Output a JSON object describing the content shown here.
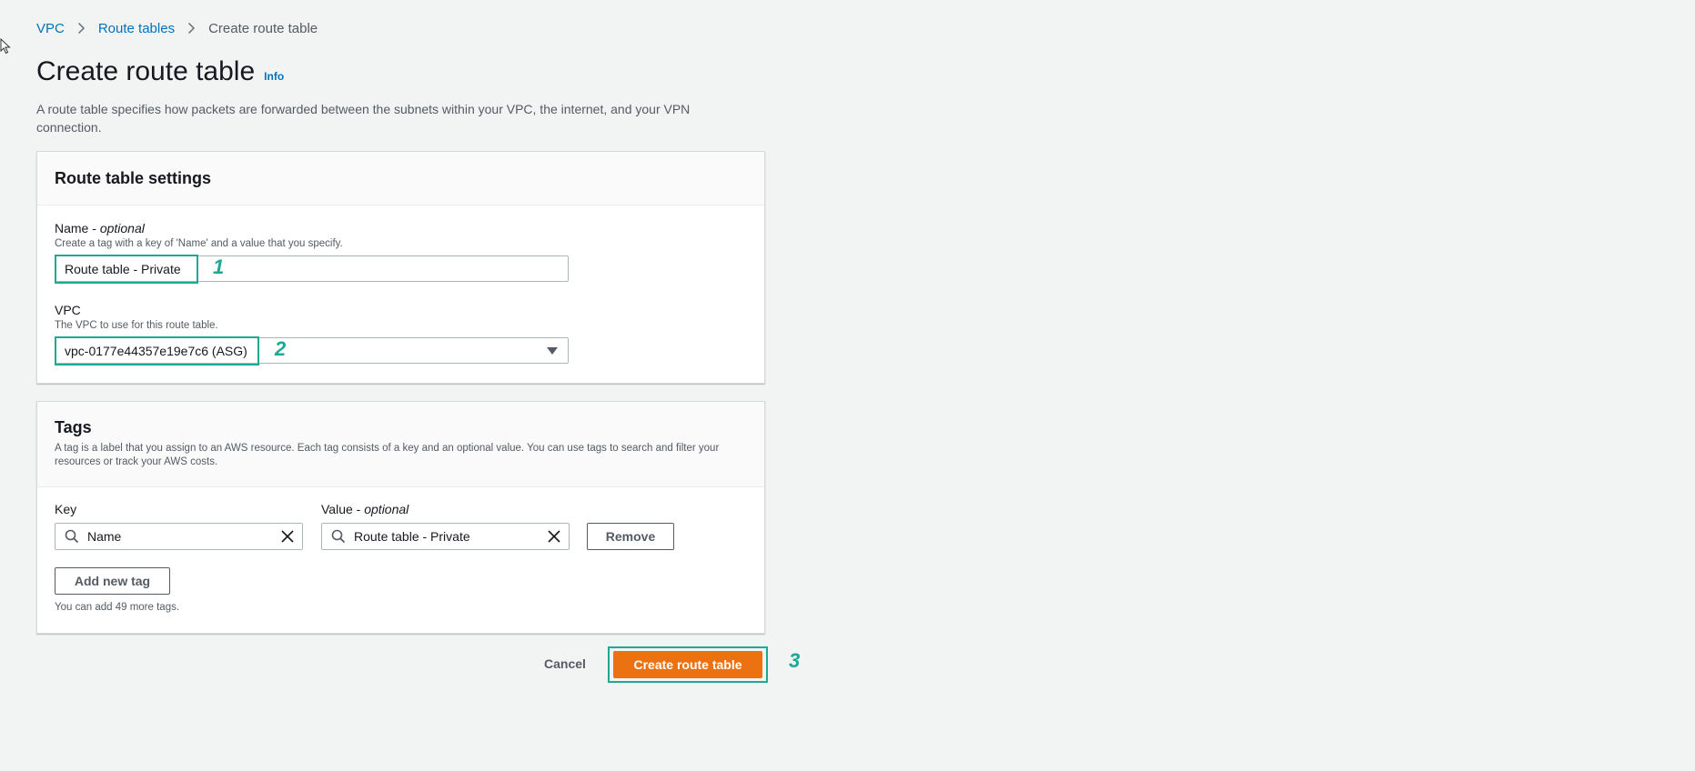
{
  "breadcrumb": {
    "items": [
      "VPC",
      "Route tables"
    ],
    "current": "Create route table"
  },
  "page": {
    "title": "Create route table",
    "info_link": "Info",
    "description": "A route table specifies how packets are forwarded between the subnets within your VPC, the internet, and your VPN connection."
  },
  "settings": {
    "heading": "Route table settings",
    "name_label": "Name",
    "name_optional": "optional",
    "name_hint": "Create a tag with a key of 'Name' and a value that you specify.",
    "name_value": "Route table - Private",
    "vpc_label": "VPC",
    "vpc_hint": "The VPC to use for this route table.",
    "vpc_value": "vpc-0177e44357e19e7c6 (ASG)"
  },
  "tags": {
    "heading": "Tags",
    "description": "A tag is a label that you assign to an AWS resource. Each tag consists of a key and an optional value. You can use tags to search and filter your resources or track your AWS costs.",
    "key_label": "Key",
    "value_label": "Value",
    "value_optional": "optional",
    "rows": [
      {
        "key": "Name",
        "value": "Route table - Private"
      }
    ],
    "remove_label": "Remove",
    "add_label": "Add new tag",
    "limit_hint": "You can add 49 more tags."
  },
  "footer": {
    "cancel_label": "Cancel",
    "submit_label": "Create route table"
  },
  "annotations": [
    "1",
    "2",
    "3"
  ],
  "colors": {
    "link": "#0073bb",
    "primary": "#ec7211",
    "highlight": "#1ea896",
    "background": "#f2f3f3"
  },
  "icons": [
    "cursor-arrow-icon",
    "chevron-right-icon",
    "search-icon",
    "clear-x-icon",
    "caret-down-icon"
  ]
}
